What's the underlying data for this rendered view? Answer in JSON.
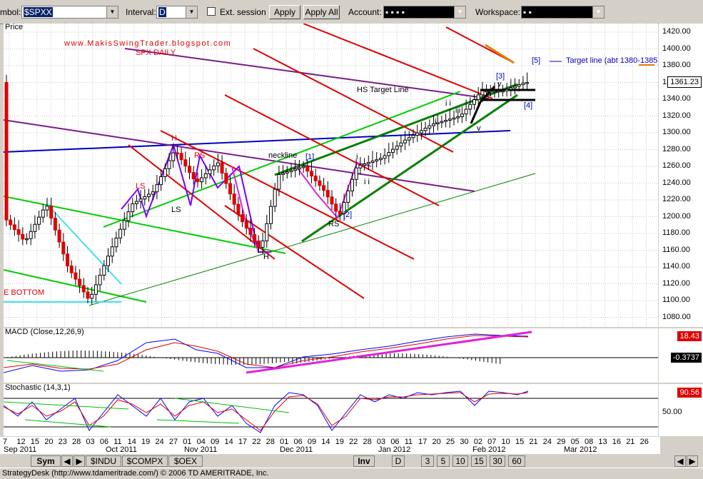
{
  "toolbar": {
    "symbol_label": "mbol:",
    "symbol_value": "$SPXX",
    "interval_label": "Interval:",
    "interval_value": "D",
    "ext_session_label": "Ext. session",
    "apply_label": "Apply",
    "apply_all_label": "Apply All",
    "account_label": "Account:",
    "account_value": "▪  ▪  ▪  ▪",
    "workspace_label": "Workspace:",
    "workspace_value": "▪  ▪"
  },
  "price_panel": {
    "label": "Price",
    "current_price": "1361.23"
  },
  "price_ticks": [
    "1420.00",
    "1400.00",
    "1380.00",
    "1360.00",
    "1340.00",
    "1320.00",
    "1300.00",
    "1280.00",
    "1260.00",
    "1240.00",
    "1220.00",
    "1200.00",
    "1180.00",
    "1160.00",
    "1140.00",
    "1120.00",
    "1100.00",
    "1080.00"
  ],
  "annotations": {
    "blog": "www.MakisSwingTrader.blogspot.com",
    "title": "SPX DAILY",
    "target_marker": "[5]",
    "target_line": "Target line (abt 1380-1385)",
    "hs_target": "HS Target Line",
    "neckline": "neckline",
    "bottom": "E BOTTOM",
    "wave3": "[3]",
    "wave4": "[4]",
    "wave1": "[1]",
    "wave2": "[2]",
    "H1": "H",
    "H2": "H",
    "LS1": "LS",
    "LS2": "LS",
    "RS1": "RS",
    "RS2": "RS",
    "v1": "v",
    "v2": "v",
    "i1": "i",
    "i2": "i",
    "ii1": "i i",
    "ii2": "i i",
    "iii": "iii"
  },
  "macd": {
    "label": "MACD (Close,12,26,9)",
    "value1": "18.43",
    "value2": "-0.3737"
  },
  "stochastic": {
    "label": "Stochastic (14,3,1)",
    "value": "90.56",
    "tick": "50.00"
  },
  "date_days": [
    "7",
    "12",
    "15",
    "20",
    "23",
    "28",
    "03",
    "06",
    "11",
    "14",
    "19",
    "24",
    "27",
    "01",
    "04",
    "09",
    "14",
    "17",
    "22",
    "28",
    "01",
    "06",
    "09",
    "14",
    "19",
    "22",
    "28",
    "03",
    "06",
    "11",
    "17",
    "20",
    "25",
    "30",
    "02",
    "07",
    "10",
    "15",
    "21",
    "24",
    "29",
    "05",
    "08",
    "13",
    "16",
    "21",
    "26"
  ],
  "date_months": [
    "Sep 2011",
    "Oct 2011",
    "Nov 2011",
    "Dec 2011",
    "Jan 2012",
    "Feb 2012",
    "Mar 2012"
  ],
  "tabs": [
    "Sym",
    "$INDU",
    "$COMPX",
    "$OEX",
    "Inv",
    "D",
    "3",
    "5",
    "10",
    "15",
    "30",
    "60"
  ],
  "status": "StrategyDesk (http://www.tdameritrade.com/) © 2006 TD AMERITRADE, Inc.",
  "colors": {
    "green": "#00a000",
    "red": "#e00000",
    "blue": "#0000c0",
    "purple": "#7a1a8a",
    "magenta": "#e020e0",
    "cyan": "#40e0f0",
    "darkgreen": "#008000",
    "orange": "#e08000"
  },
  "chart_data": {
    "type": "candlestick",
    "title": "SPX DAILY",
    "ylabel": "Price",
    "ylim": [
      1080,
      1420
    ],
    "x": [
      "Sep 2011",
      "Oct 2011",
      "Nov 2011",
      "Dec 2011",
      "Jan 2012",
      "Feb 2012"
    ],
    "close_approx": [
      1200,
      1100,
      1260,
      1160,
      1250,
      1361.23
    ],
    "indicators": [
      {
        "name": "MACD (Close,12,26,9)",
        "values": [
          18.43,
          -0.3737
        ]
      },
      {
        "name": "Stochastic (14,3,1)",
        "values": [
          90.56
        ]
      }
    ]
  }
}
